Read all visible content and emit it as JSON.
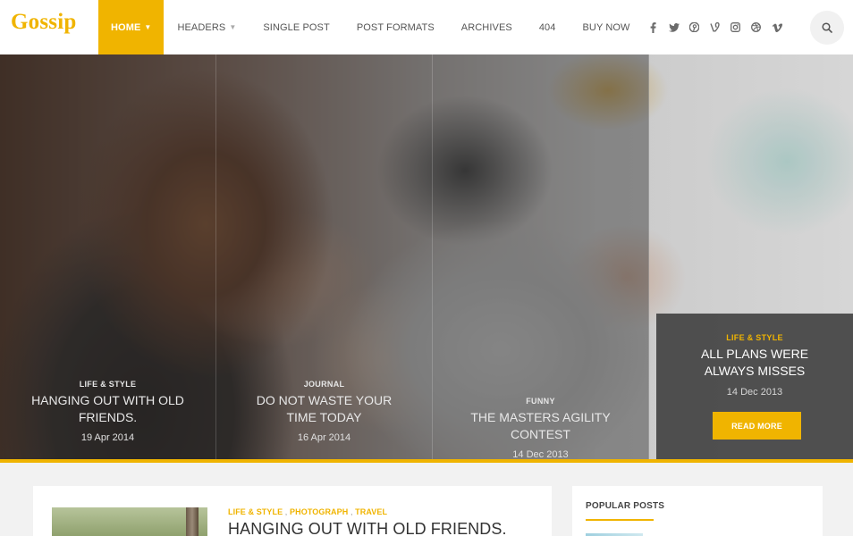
{
  "header": {
    "logo": "Gossip",
    "nav": [
      {
        "label": "HOME",
        "active": true,
        "has_dropdown": true
      },
      {
        "label": "HEADERS",
        "active": false,
        "has_dropdown": true
      },
      {
        "label": "SINGLE POST",
        "active": false,
        "has_dropdown": false
      },
      {
        "label": "POST FORMATS",
        "active": false,
        "has_dropdown": false
      },
      {
        "label": "ARCHIVES",
        "active": false,
        "has_dropdown": false
      },
      {
        "label": "404",
        "active": false,
        "has_dropdown": false
      },
      {
        "label": "BUY NOW",
        "active": false,
        "has_dropdown": false
      }
    ],
    "social_icons": [
      "facebook-icon",
      "twitter-icon",
      "pinterest-icon",
      "vine-icon",
      "instagram-icon",
      "dribbble-icon",
      "vimeo-icon"
    ],
    "search_icon": "search-icon"
  },
  "hero": {
    "slides": [
      {
        "category": "LIFE & STYLE",
        "title": "HANGING OUT WITH OLD FRIENDS.",
        "date": "19 Apr 2014"
      },
      {
        "category": "JOURNAL",
        "title": "DO NOT WASTE YOUR TIME TODAY",
        "date": "16 Apr 2014"
      },
      {
        "category": "FUNNY",
        "title": "THE MASTERS AGILITY CONTEST",
        "date": "14 Dec 2013"
      }
    ],
    "featured": {
      "category": "LIFE & STYLE",
      "title": "ALL PLANS WERE ALWAYS MISSES",
      "date": "14 Dec 2013",
      "button": "READ MORE"
    }
  },
  "post": {
    "categories": [
      "LIFE & STYLE",
      "PHOTOGRAPH",
      "TRAVEL"
    ],
    "title": "HANGING OUT WITH OLD FRIENDS."
  },
  "sidebar": {
    "popular_title": "POPULAR POSTS"
  },
  "colors": {
    "accent": "#f0b400",
    "dark_overlay": "#464646",
    "text_dark": "#333333"
  }
}
